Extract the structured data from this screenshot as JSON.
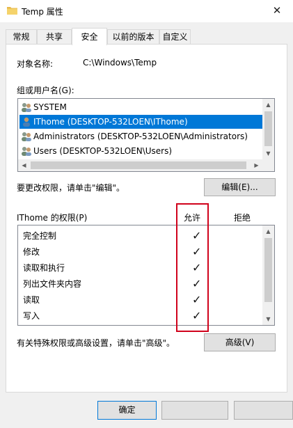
{
  "window": {
    "title": "Temp 属性",
    "close_glyph": "✕"
  },
  "tabs": [
    {
      "label": "常规",
      "active": false
    },
    {
      "label": "共享",
      "active": false
    },
    {
      "label": "安全",
      "active": true
    },
    {
      "label": "以前的版本",
      "active": false
    },
    {
      "label": "自定义",
      "active": false
    }
  ],
  "object_name": {
    "label": "对象名称:",
    "value": "C:\\Windows\\Temp"
  },
  "groups": {
    "label": "组或用户名(G):",
    "items": [
      {
        "name": "SYSTEM",
        "icon": "users-group-icon",
        "selected": false
      },
      {
        "name": "IThome (DESKTOP-532LOEN\\IThome)",
        "icon": "user-icon",
        "selected": true
      },
      {
        "name": "Administrators (DESKTOP-532LOEN\\Administrators)",
        "icon": "users-group-icon",
        "selected": false
      },
      {
        "name": "Users (DESKTOP-532LOEN\\Users)",
        "icon": "users-group-icon",
        "selected": false
      }
    ]
  },
  "edit_hint": "要更改权限，请单击\"编辑\"。",
  "edit_button": "编辑(E)...",
  "permissions": {
    "label": "IThome 的权限(P)",
    "allow_header": "允许",
    "deny_header": "拒绝",
    "check_glyph": "✓",
    "rows": [
      {
        "name": "完全控制",
        "allow": true,
        "deny": false
      },
      {
        "name": "修改",
        "allow": true,
        "deny": false
      },
      {
        "name": "读取和执行",
        "allow": true,
        "deny": false
      },
      {
        "name": "列出文件夹内容",
        "allow": true,
        "deny": false
      },
      {
        "name": "读取",
        "allow": true,
        "deny": false
      },
      {
        "name": "写入",
        "allow": true,
        "deny": false
      }
    ]
  },
  "advanced_hint": "有关特殊权限或高级设置，请单击\"高级\"。",
  "advanced_button": "高级(V)",
  "ok_button": "确定",
  "colors": {
    "highlight": "#0078d7",
    "red_frame": "#d0021b"
  }
}
